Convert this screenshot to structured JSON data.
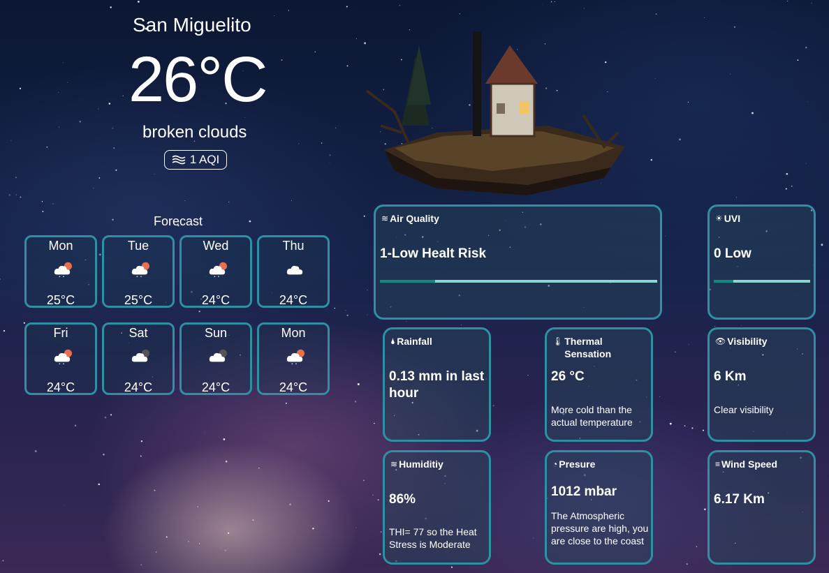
{
  "current": {
    "city": "San Miguelito",
    "temperature": "26°C",
    "description": "broken clouds",
    "aqi_label": "1 AQI"
  },
  "forecast": {
    "title": "Forecast",
    "days": [
      {
        "day": "Mon",
        "temp": "25°C",
        "icon": "cloud-sun-rain-icon"
      },
      {
        "day": "Tue",
        "temp": "25°C",
        "icon": "cloud-sun-rain-icon"
      },
      {
        "day": "Wed",
        "temp": "24°C",
        "icon": "cloud-sun-rain-icon"
      },
      {
        "day": "Thu",
        "temp": "24°C",
        "icon": "cloud-icon"
      },
      {
        "day": "Fri",
        "temp": "24°C",
        "icon": "cloud-sun-rain-icon"
      },
      {
        "day": "Sat",
        "temp": "24°C",
        "icon": "cloud-moon-icon"
      },
      {
        "day": "Sun",
        "temp": "24°C",
        "icon": "cloud-moon-icon"
      },
      {
        "day": "Mon",
        "temp": "24°C",
        "icon": "cloud-sun-rain-icon"
      }
    ]
  },
  "metrics": {
    "air_quality": {
      "title": "Air Quality",
      "value": "1-Low Healt Risk",
      "level": 0.2,
      "icon": "air-icon"
    },
    "uvi": {
      "title": "UVI",
      "value": "0 Low",
      "level": 0.2,
      "icon": "sun-icon"
    },
    "rainfall": {
      "title": "Rainfall",
      "value": "0.13 mm in last hour",
      "icon": "raindrop-icon"
    },
    "thermal": {
      "title": "Thermal Sensation",
      "value": "26 °C",
      "note": "More cold than the actual temperature",
      "icon": "thermometer-icon"
    },
    "visibility": {
      "title": "Visibility",
      "value": "6 Km",
      "note": "Clear visibility",
      "icon": "eye-icon"
    },
    "humidity": {
      "title": "Humiditiy",
      "value": "86%",
      "note": "THI= 77 so the Heat Stress is Moderate",
      "icon": "humidity-icon"
    },
    "pressure": {
      "title": "Presure",
      "value": "1012 mbar",
      "note": "The Atmospheric pressure are high, you are close to the coast",
      "icon": "gauge-icon"
    },
    "wind": {
      "title": "Wind Speed",
      "value": "6.17 Km",
      "icon": "wind-icon"
    }
  },
  "colors": {
    "card_border": "#2f8fa3",
    "bar_fill": "#128a80",
    "bar_track": "#8fd6cf"
  }
}
